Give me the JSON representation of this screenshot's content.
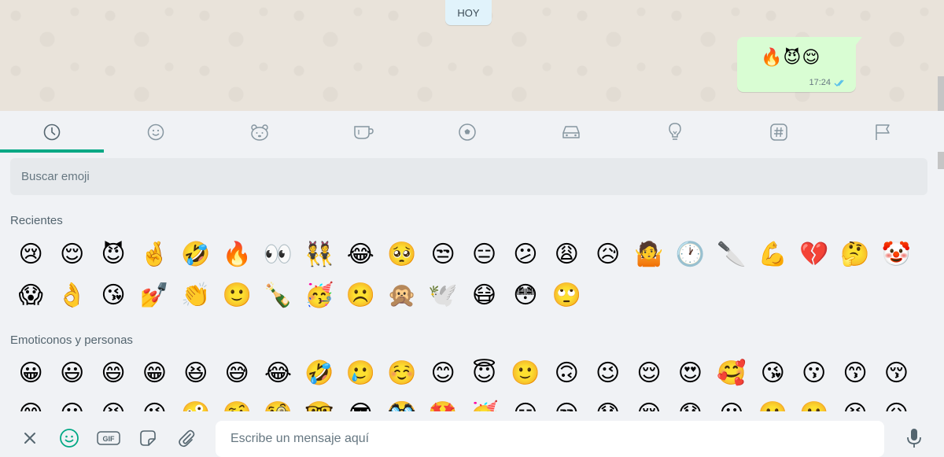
{
  "chat": {
    "date_chip": "HOY",
    "message": {
      "emojis": "🔥😈😌",
      "time": "17:24",
      "status": "read-double-check"
    }
  },
  "emoji_panel": {
    "tabs": [
      {
        "icon": "clock-icon",
        "name": "recientes",
        "active": true
      },
      {
        "icon": "smiley-icon",
        "name": "emoticonos",
        "active": false
      },
      {
        "icon": "bear-icon",
        "name": "animales",
        "active": false
      },
      {
        "icon": "cup-icon",
        "name": "comida",
        "active": false
      },
      {
        "icon": "ball-icon",
        "name": "actividades",
        "active": false
      },
      {
        "icon": "car-icon",
        "name": "viajes",
        "active": false
      },
      {
        "icon": "bulb-icon",
        "name": "objetos",
        "active": false
      },
      {
        "icon": "hash-icon",
        "name": "simbolos",
        "active": false
      },
      {
        "icon": "flag-icon",
        "name": "banderas",
        "active": false
      }
    ],
    "search_placeholder": "Buscar emoji",
    "accent_color": "#00a884",
    "sections": {
      "recent": {
        "title": "Recientes",
        "emojis": [
          "😢",
          "😌",
          "😈",
          "🤞",
          "🤣",
          "🔥",
          "👀",
          "👯",
          "😂",
          "🥺",
          "😒",
          "😑",
          "😕",
          "😩",
          "😥",
          "🤷",
          "🕐",
          "🔪",
          "💪",
          "💔",
          "🤔",
          "🤡",
          "😱",
          "👌",
          "😘",
          "💅",
          "👏",
          "🙂",
          "🍾",
          "🥳",
          "☹️",
          "🙊",
          "🕊️",
          "😷",
          "😳",
          "🙄"
        ]
      },
      "people": {
        "title": "Emoticonos y personas",
        "emojis": [
          "😀",
          "😃",
          "😄",
          "😁",
          "😆",
          "😅",
          "😂",
          "🤣",
          "🥲",
          "☺️",
          "😊",
          "😇",
          "🙂",
          "🙃",
          "😉",
          "😌",
          "😍",
          "🥰",
          "😘",
          "😗",
          "😙",
          "😚",
          "😋",
          "😛",
          "😝",
          "😜",
          "🤪",
          "🤨",
          "🧐",
          "🤓",
          "😎",
          "🥸",
          "🤩",
          "🥳",
          "😏",
          "😒",
          "😞",
          "😔",
          "😟",
          "😕",
          "🙁",
          "☹️",
          "😣",
          "😖"
        ]
      }
    }
  },
  "composer": {
    "placeholder": "Escribe un mensaje aquí",
    "buttons": [
      {
        "icon": "close-icon",
        "label": "✕"
      },
      {
        "icon": "emoji-icon",
        "label": "emoji",
        "active": true
      },
      {
        "icon": "gif-icon",
        "label": "GIF"
      },
      {
        "icon": "sticker-icon",
        "label": "sticker"
      },
      {
        "icon": "attach-icon",
        "label": "attach"
      },
      {
        "icon": "mic-icon",
        "label": "mic"
      }
    ]
  }
}
